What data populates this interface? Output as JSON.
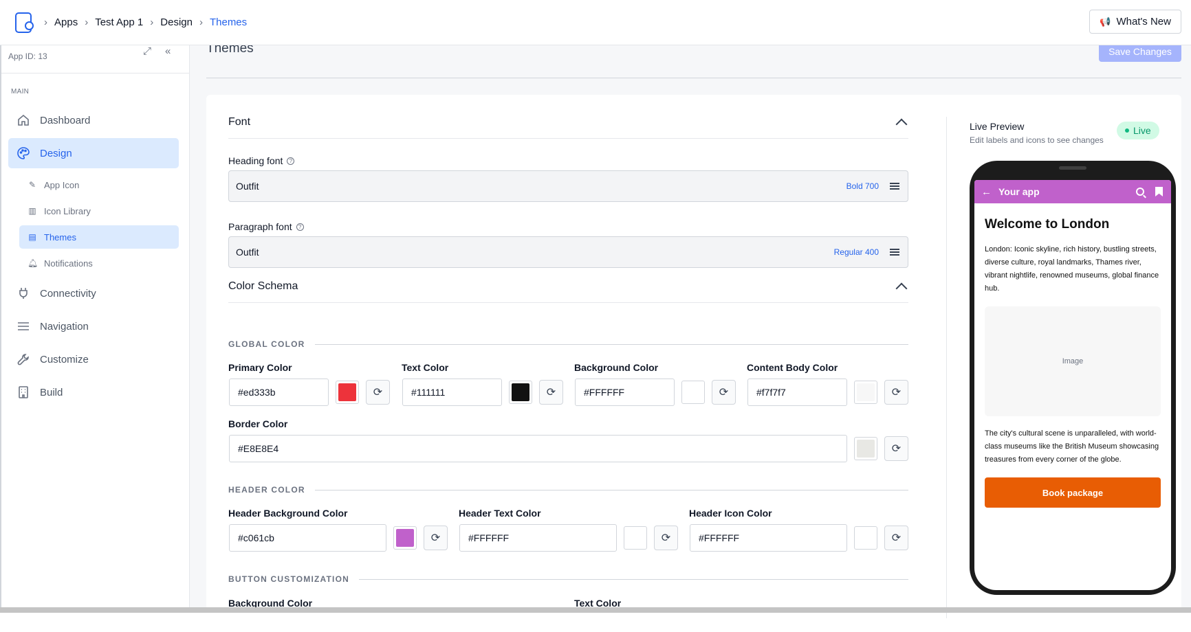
{
  "breadcrumbs": [
    "Apps",
    "Test App 1",
    "Design",
    "Themes"
  ],
  "whats_new_label": "What's New",
  "sidebar": {
    "app_id": "App ID: 13",
    "section_label": "MAIN",
    "items": [
      {
        "label": "Dashboard",
        "icon": "home-icon"
      },
      {
        "label": "Design",
        "icon": "palette-icon"
      },
      {
        "label": "Connectivity",
        "icon": "plug-icon"
      },
      {
        "label": "Navigation",
        "icon": "menu-icon"
      },
      {
        "label": "Customize",
        "icon": "wrench-icon"
      },
      {
        "label": "Build",
        "icon": "building-icon"
      }
    ],
    "sub_items": [
      {
        "label": "App Icon",
        "icon": "pencil-icon"
      },
      {
        "label": "Icon Library",
        "icon": "library-icon"
      },
      {
        "label": "Themes",
        "icon": "layout-icon"
      },
      {
        "label": "Notifications",
        "icon": "bell-icon"
      }
    ]
  },
  "page": {
    "title": "Themes",
    "save_label": "Save Changes"
  },
  "font_section": {
    "title": "Font",
    "heading_label": "Heading font",
    "heading_value": "Outfit",
    "heading_weight": "Bold 700",
    "paragraph_label": "Paragraph font",
    "paragraph_value": "Outfit",
    "paragraph_weight": "Regular 400"
  },
  "color_section": {
    "title": "Color Schema",
    "global_title": "GLOBAL COLOR",
    "primary_label": "Primary Color",
    "primary_value": "#ed333b",
    "text_label": "Text Color",
    "text_value": "#111111",
    "bg_label": "Background Color",
    "bg_value": "#FFFFFF",
    "content_label": "Content Body Color",
    "content_value": "#f7f7f7",
    "border_label": "Border Color",
    "border_value": "#E8E8E4",
    "header_title": "HEADER COLOR",
    "header_bg_label": "Header Background Color",
    "header_bg_value": "#c061cb",
    "header_text_label": "Header Text Color",
    "header_text_value": "#FFFFFF",
    "header_icon_label": "Header Icon Color",
    "header_icon_value": "#FFFFFF",
    "button_title": "BUTTON CUSTOMIZATION",
    "btn_bg_label": "Background Color",
    "btn_text_label": "Text Color"
  },
  "preview": {
    "title": "Live Preview",
    "subtitle": "Edit labels and icons to see changes",
    "badge": "Live",
    "app_title": "Your app",
    "heading": "Welcome to London",
    "paragraph1": "London: Iconic skyline, rich history, bustling streets, diverse culture, royal landmarks, Thames river, vibrant nightlife, renowned museums, global finance hub.",
    "image_label": "Image",
    "paragraph2": "The city's cultural scene is unparalleled, with world-class museums like the British Museum showcasing treasures from every corner of the globe.",
    "button_label": "Book package"
  },
  "colors": {
    "accent": "#2563eb",
    "primary": "#ed333b",
    "header_bg": "#c061cb",
    "book_button": "#e85d04",
    "save_button": "#a5b4fc"
  }
}
